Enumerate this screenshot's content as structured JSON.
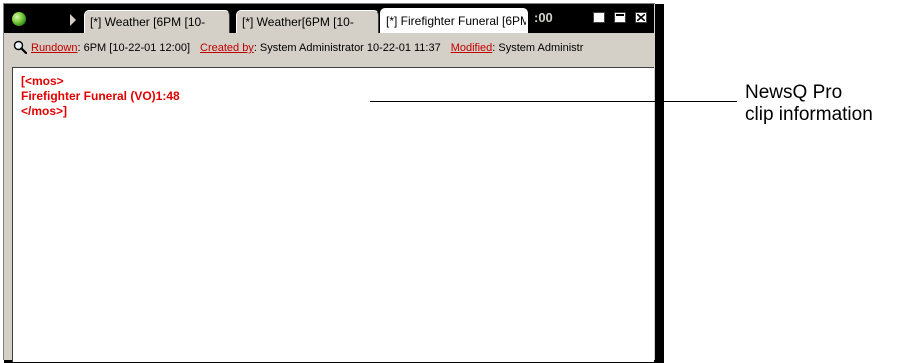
{
  "app": {
    "icon": "green-orb-icon",
    "scroll_icon": "tab-scroll-right-icon"
  },
  "tabs": [
    {
      "label": "[*] Weather [6PM [10-",
      "active": false
    },
    {
      "label": "[*] Weather[6PM [10-",
      "active": false
    },
    {
      "label": "[*] Firefighter Funeral [6PM",
      "active": true
    }
  ],
  "clock": ":00",
  "window_controls": {
    "minimize_icon": "minimize-icon",
    "maximize_icon": "maximize-icon",
    "close_icon": "close-icon"
  },
  "info": {
    "search_icon": "magnifier-icon",
    "rundown_label": "Rundown",
    "rundown_value": ": 6PM [10-22-01 12:00]",
    "created_label": "Created by",
    "created_value": ": System Administrator   10-22-01 11:37",
    "modified_label": "Modified",
    "modified_value": ": System Administr"
  },
  "editor": {
    "lines": [
      "[<mos>",
      "Firefighter Funeral (VO)1:48",
      "</mos>]"
    ],
    "text_color": "#e00000"
  },
  "callout": {
    "line1": "NewsQ Pro",
    "line2": "clip information"
  }
}
